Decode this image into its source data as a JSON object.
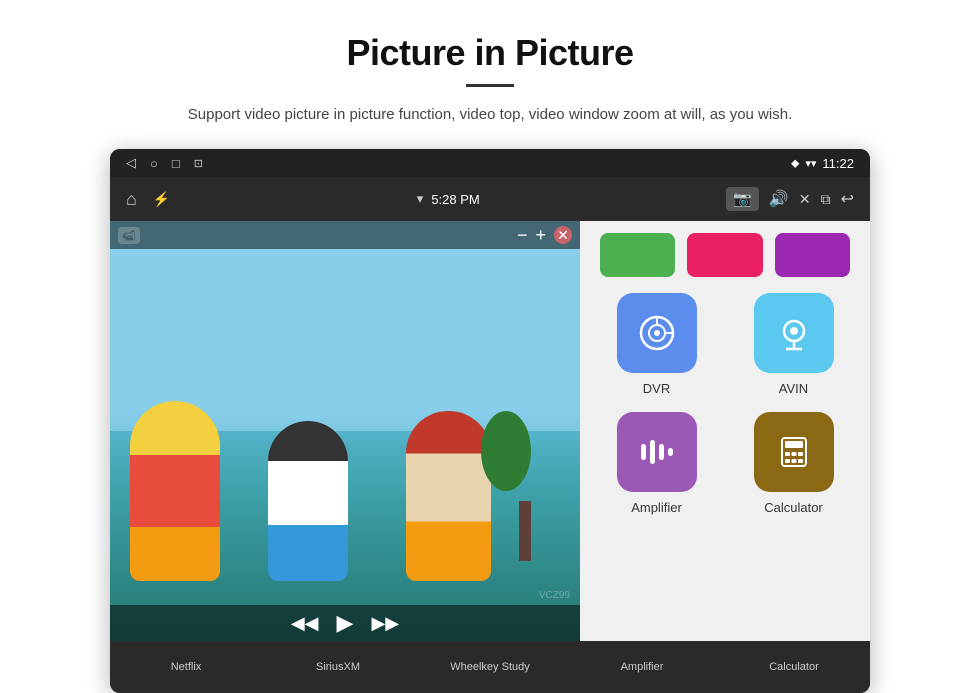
{
  "header": {
    "title": "Picture in Picture",
    "subtitle": "Support video picture in picture function, video top, video window zoom at will, as you wish."
  },
  "statusBar": {
    "time": "11:22",
    "appTime": "5:28 PM",
    "icons": {
      "back": "◁",
      "home": "○",
      "recent": "□",
      "cast": "⊡"
    }
  },
  "pipControls": {
    "minus": "−",
    "plus": "+",
    "close": "✕",
    "rewind": "◀◀",
    "play": "▶",
    "forward": "▶▶"
  },
  "apps": {
    "topRow": [
      {
        "color": "#4CAF50",
        "label": ""
      },
      {
        "color": "#E91E63",
        "label": ""
      },
      {
        "color": "#9C27B0",
        "label": ""
      }
    ],
    "grid": [
      {
        "id": "dvr",
        "label": "DVR",
        "bgColor": "#5B8DEF"
      },
      {
        "id": "avin",
        "label": "AVIN",
        "bgColor": "#5BC8EF"
      },
      {
        "id": "amplifier",
        "label": "Amplifier",
        "bgColor": "#9B59B6"
      },
      {
        "id": "calculator",
        "label": "Calculator",
        "bgColor": "#8B5E14"
      }
    ],
    "bottomRow": [
      {
        "id": "netflix",
        "label": "Netflix"
      },
      {
        "id": "siriusxm",
        "label": "SiriusXM"
      },
      {
        "id": "wheelkey",
        "label": "Wheelkey Study"
      },
      {
        "id": "amplifier",
        "label": "Amplifier"
      },
      {
        "id": "calculator",
        "label": "Calculator"
      }
    ]
  }
}
